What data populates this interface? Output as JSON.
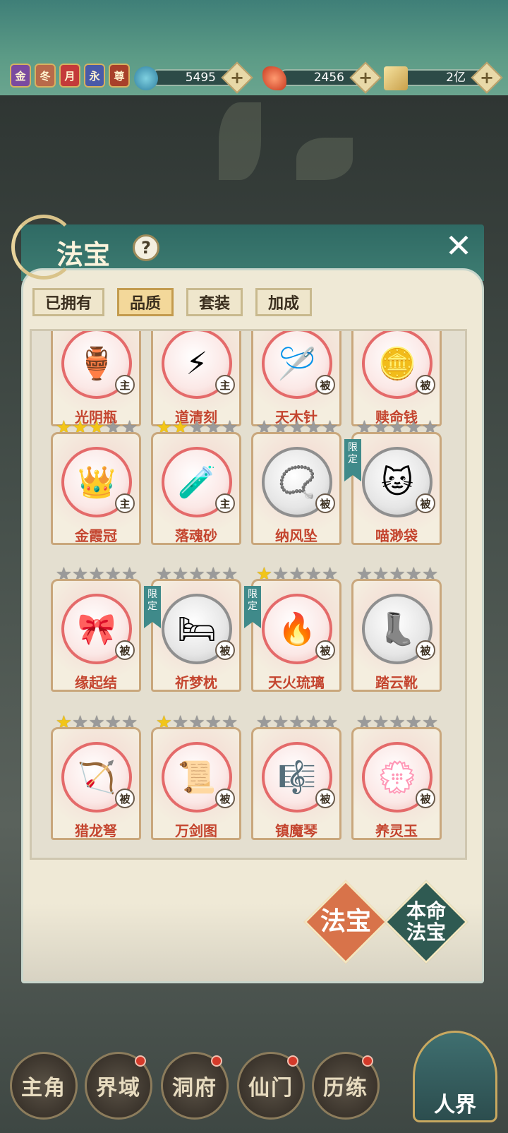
{
  "topbar": {
    "badges": [
      {
        "label": "金",
        "color": "#7a4aa0"
      },
      {
        "label": "冬",
        "color": "#b86a4a"
      },
      {
        "label": "月",
        "color": "#c43a3a"
      },
      {
        "label": "永",
        "color": "#4a5aa8"
      },
      {
        "label": "尊",
        "color": "#a8402a"
      }
    ],
    "resources": [
      {
        "icon": "jade-swirl-icon",
        "value": "5495",
        "color": "#3f8fb0"
      },
      {
        "icon": "red-crystal-icon",
        "value": "2456",
        "color": "#e05a3a"
      },
      {
        "icon": "gold-scroll-icon",
        "value": "2亿",
        "color": "#d8b860"
      }
    ]
  },
  "panel": {
    "title": "法宝",
    "help_label": "?",
    "close_label": "✕",
    "tabs": [
      {
        "label": "已拥有",
        "active": false
      },
      {
        "label": "品质",
        "active": true
      },
      {
        "label": "套装",
        "active": false
      },
      {
        "label": "加成",
        "active": false
      }
    ],
    "items": [
      {
        "name": "光阴瓶",
        "tag": "主",
        "stars": 0,
        "show_stars": false,
        "gray": false,
        "limited": false,
        "icon": "porcelain-vase-icon",
        "glyph": "🏺"
      },
      {
        "name": "道清刻",
        "tag": "主",
        "stars": 0,
        "show_stars": false,
        "gray": false,
        "limited": false,
        "icon": "golden-talisman-icon",
        "glyph": "⚡"
      },
      {
        "name": "天木针",
        "tag": "被",
        "stars": 0,
        "show_stars": false,
        "gray": false,
        "limited": false,
        "icon": "wooden-needle-icon",
        "glyph": "🪡"
      },
      {
        "name": "赎命钱",
        "tag": "被",
        "stars": 0,
        "show_stars": false,
        "gray": false,
        "limited": false,
        "icon": "copper-coins-icon",
        "glyph": "🪙"
      },
      {
        "name": "金霞冠",
        "tag": "主",
        "stars": 3,
        "show_stars": true,
        "gray": false,
        "limited": false,
        "icon": "crown-icon",
        "glyph": "👑"
      },
      {
        "name": "落魂砂",
        "tag": "主",
        "stars": 2,
        "show_stars": true,
        "gray": false,
        "limited": false,
        "icon": "sand-gourd-icon",
        "glyph": "🧪"
      },
      {
        "name": "纳风坠",
        "tag": "被",
        "stars": 0,
        "show_stars": true,
        "gray": true,
        "limited": false,
        "icon": "pendant-icon",
        "glyph": "📿"
      },
      {
        "name": "喵渺袋",
        "tag": "被",
        "stars": 0,
        "show_stars": true,
        "gray": true,
        "limited": true,
        "limited_label": "限定",
        "icon": "cat-bag-icon",
        "glyph": "🐱"
      },
      {
        "name": "缘起结",
        "tag": "被",
        "stars": 0,
        "show_stars": true,
        "gray": false,
        "limited": false,
        "icon": "red-knot-icon",
        "glyph": "🎀"
      },
      {
        "name": "祈梦枕",
        "tag": "被",
        "stars": 0,
        "show_stars": true,
        "gray": true,
        "limited": true,
        "limited_label": "限定",
        "icon": "pillow-icon",
        "glyph": "🛏"
      },
      {
        "name": "天火琉璃",
        "tag": "被",
        "stars": 1,
        "show_stars": true,
        "gray": false,
        "limited": true,
        "limited_label": "限定",
        "icon": "fire-bottle-icon",
        "glyph": "🔥"
      },
      {
        "name": "踏云靴",
        "tag": "被",
        "stars": 0,
        "show_stars": true,
        "gray": true,
        "limited": false,
        "icon": "cloud-boot-icon",
        "glyph": "👢"
      },
      {
        "name": "猎龙弩",
        "tag": "被",
        "stars": 1,
        "show_stars": true,
        "gray": false,
        "limited": false,
        "icon": "crossbow-icon",
        "glyph": "🏹"
      },
      {
        "name": "万剑图",
        "tag": "被",
        "stars": 1,
        "show_stars": true,
        "gray": false,
        "limited": false,
        "icon": "scroll-icon",
        "glyph": "📜"
      },
      {
        "name": "镇魔琴",
        "tag": "被",
        "stars": 0,
        "show_stars": true,
        "gray": false,
        "limited": false,
        "icon": "zither-icon",
        "glyph": "🎼"
      },
      {
        "name": "养灵玉",
        "tag": "被",
        "stars": 0,
        "show_stars": true,
        "gray": false,
        "limited": false,
        "icon": "jade-pendant-icon",
        "glyph": "💮"
      }
    ],
    "buttons": {
      "fabao": {
        "label": "法宝",
        "color": "#d8734a"
      },
      "benming": {
        "label": "本命法宝",
        "color": "#2f5a52"
      }
    }
  },
  "nav": {
    "items": [
      {
        "label": "主角",
        "dot": false
      },
      {
        "label": "界域",
        "dot": true
      },
      {
        "label": "洞府",
        "dot": true
      },
      {
        "label": "仙门",
        "dot": true
      },
      {
        "label": "历练",
        "dot": true
      }
    ],
    "realm_label": "人界"
  }
}
